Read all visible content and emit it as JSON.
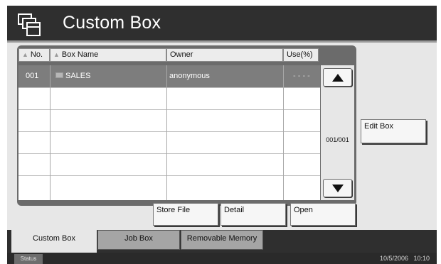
{
  "header": {
    "title": "Custom Box"
  },
  "list": {
    "columns": {
      "no": "No.",
      "box_name": "Box Name",
      "owner": "Owner",
      "use": "Use(%)"
    },
    "rows": [
      {
        "no": "001",
        "box_name": "SALES",
        "owner": "anonymous",
        "use": "- - - -"
      }
    ],
    "page_indicator": "001/001"
  },
  "buttons": {
    "edit_box": "Edit Box",
    "store_file": "Store File",
    "detail": "Detail",
    "open": "Open"
  },
  "tabs": [
    {
      "label": "Custom Box",
      "active": true
    },
    {
      "label": "Job Box",
      "active": false
    },
    {
      "label": "Removable Memory",
      "active": false
    }
  ],
  "status": {
    "label": "Status",
    "datetime": "10/5/2006   10:10"
  },
  "icons": {
    "header": "custom-box-icon",
    "sort": "sort-triangle-icon",
    "folder": "folder-icon",
    "scroll_up": "arrow-up-icon",
    "scroll_down": "arrow-down-icon"
  },
  "colors": {
    "header_bg": "#2f2f2f",
    "panel_bg": "#e7e7e7",
    "selected_row": "#7d7d7d"
  }
}
